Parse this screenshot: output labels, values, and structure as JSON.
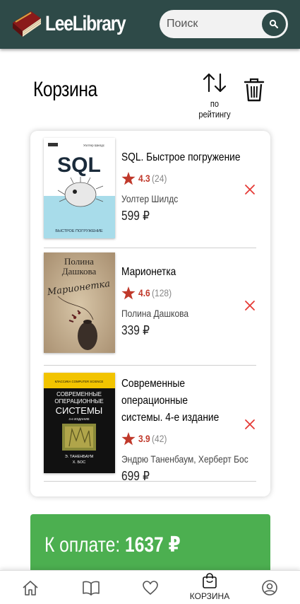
{
  "app": {
    "logo_text": "LeeLibrary"
  },
  "search": {
    "placeholder": "Поиск"
  },
  "page": {
    "title": "Корзина",
    "sort_label": "по рейтингу"
  },
  "cart": {
    "items": [
      {
        "title": "SQL. Быстрое погружение",
        "rating": "4.3",
        "rating_count": "(24)",
        "author": "Уолтер Шилдс",
        "price": "599 ₽",
        "cover": {
          "author_line": "Уолтер Шилдс",
          "big_title": "SQL",
          "subtitle": "БЫСТРОЕ ПОГРУЖЕНИЕ"
        }
      },
      {
        "title": "Марионетка",
        "rating": "4.6",
        "rating_count": "(128)",
        "author": "Полина Дашкова",
        "price": "339 ₽",
        "cover": {
          "author_line1": "Полина",
          "author_line2": "Дашкова",
          "script_title": "Марионетка"
        }
      },
      {
        "title_line1": "Современные операционные",
        "title_line2": "системы. 4-е издание",
        "rating": "3.9",
        "rating_count": "(42)",
        "author": "Эндрю Таненбаум, Херберт Бос",
        "price": "699 ₽",
        "cover": {
          "series": "КЛАССИКА COMPUTER SCIENCE",
          "line1": "СОВРЕМЕННЫЕ",
          "line2": "ОПЕРАЦИОННЫЕ",
          "line3": "СИСТЕМЫ",
          "edition": "4-е ИЗДАНИЕ",
          "authors1": "Э. ТАНЕНБАУМ",
          "authors2": "Х. БОС"
        }
      }
    ]
  },
  "pay": {
    "label": "К оплате:",
    "total": "1637 ₽"
  },
  "bottom_nav": {
    "items": [
      {
        "icon": "home-icon"
      },
      {
        "icon": "book-icon"
      },
      {
        "icon": "heart-icon"
      },
      {
        "icon": "bag-icon",
        "label": "КОРЗИНА"
      },
      {
        "icon": "user-icon"
      }
    ]
  },
  "colors": {
    "header_bg": "#2e4a48",
    "accent_red": "#c0392b",
    "pay_green": "#4caf50",
    "remove_red": "#e53935"
  }
}
